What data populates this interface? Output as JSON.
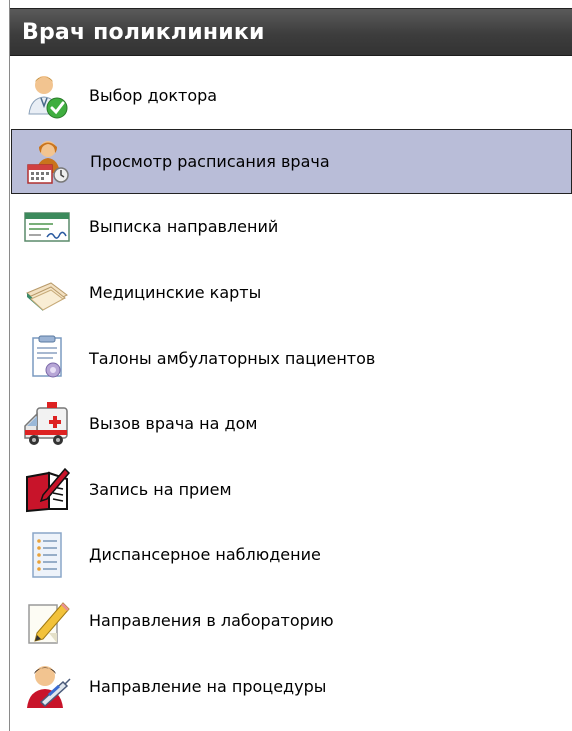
{
  "panel": {
    "title": "Врач поликлиники",
    "items": [
      {
        "label": "Выбор доктора",
        "icon": "doctor-check-icon",
        "selected": false
      },
      {
        "label": "Просмотр расписания врача",
        "icon": "doctor-schedule-icon",
        "selected": true
      },
      {
        "label": "Выписка направлений",
        "icon": "referral-form-icon",
        "selected": false
      },
      {
        "label": "Медицинские карты",
        "icon": "medical-cards-icon",
        "selected": false
      },
      {
        "label": "Талоны амбулаторных пациентов",
        "icon": "outpatient-coupon-icon",
        "selected": false
      },
      {
        "label": "Вызов врача на дом",
        "icon": "ambulance-icon",
        "selected": false
      },
      {
        "label": "Запись на прием",
        "icon": "appointment-book-icon",
        "selected": false
      },
      {
        "label": "Диспансерное наблюдение",
        "icon": "checklist-icon",
        "selected": false
      },
      {
        "label": "Направления в лабораторию",
        "icon": "notepad-pencil-icon",
        "selected": false
      },
      {
        "label": "Направление на процедуры",
        "icon": "person-syringe-icon",
        "selected": false
      }
    ]
  },
  "colors": {
    "header_bg": "#3d3d3d",
    "selected_bg": "#b9bdd8"
  }
}
